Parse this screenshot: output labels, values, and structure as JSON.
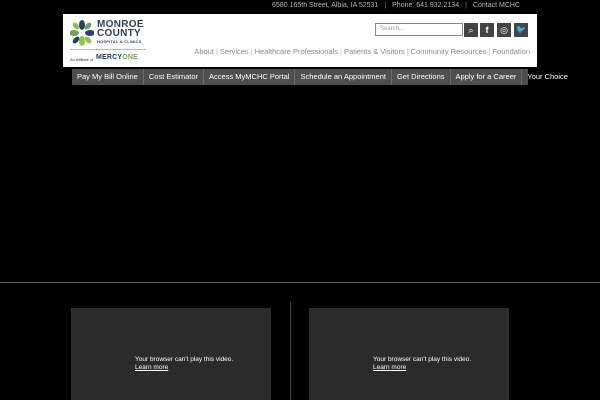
{
  "topbar": {
    "address": "6580 165th Street, Albia, IA 52531",
    "phone": "Phone: 641.932.2134",
    "contact": "Contact MCHC"
  },
  "logo": {
    "line1": "MONROE",
    "line2": "COUNTY",
    "line3": "HOSPITAL & CLINICS",
    "affiliate": "An Affiliate of",
    "mercy_a": "MERCY",
    "mercy_b": "ONE",
    "colors": [
      "#2c3e70",
      "#6aa84f",
      "#8dc63f"
    ]
  },
  "search": {
    "placeholder": "Search..."
  },
  "social": {
    "search_icon": "⌕",
    "facebook": "f",
    "instagram": "◎",
    "twitter": "🐦"
  },
  "nav": {
    "items": [
      "About",
      "Services",
      "Healthcare Professionals",
      "Patients & Visitors",
      "Community Resources",
      "Foundation"
    ]
  },
  "quickbar": {
    "items": [
      "Pay My Bill Online",
      "Cost Estimator",
      "Access MyMCHC Portal",
      "Schedule an Appointment",
      "Get Directions",
      "Apply for a Career",
      "Your Choice"
    ]
  },
  "videos": [
    {
      "message": "Your browser can't play this video.",
      "link": "Learn more"
    },
    {
      "message": "Your browser can't play this video.",
      "link": "Learn more"
    }
  ]
}
